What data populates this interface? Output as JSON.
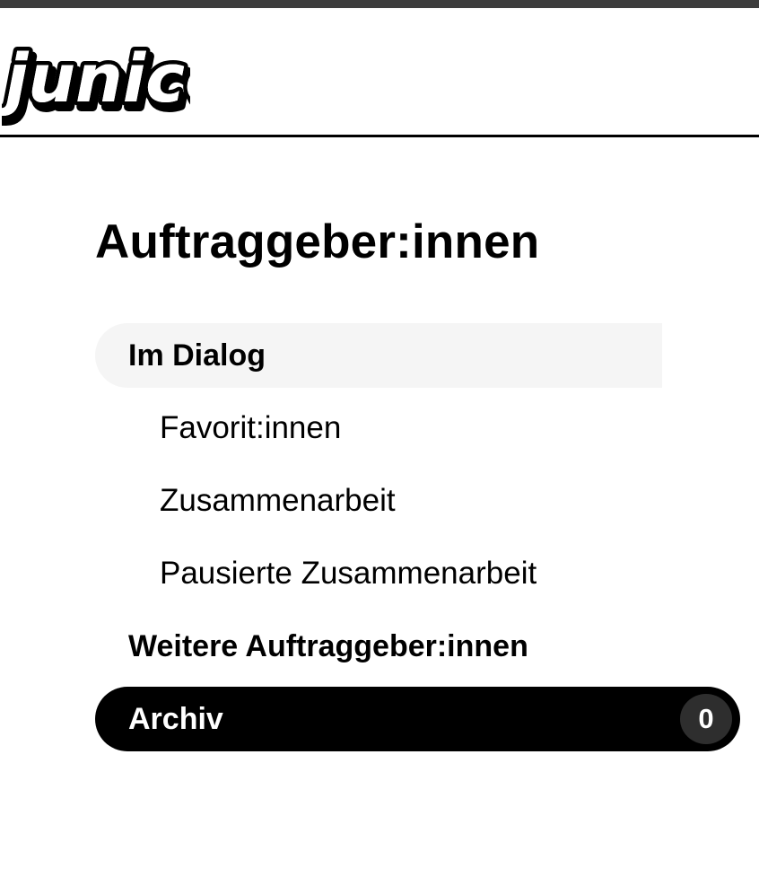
{
  "brand": {
    "logo_text": "junico",
    "logo_icon": "junico-logo"
  },
  "page": {
    "title": "Auftraggeber:innen"
  },
  "nav": {
    "items": [
      {
        "label": "Im Dialog",
        "level": "primary",
        "state": "expanded"
      },
      {
        "label": "Favorit:innen",
        "level": "sub"
      },
      {
        "label": "Zusammenarbeit",
        "level": "sub"
      },
      {
        "label": "Pausierte Zusammenarbeit",
        "level": "sub"
      },
      {
        "label": "Weitere Auftraggeber:innen",
        "level": "primary"
      },
      {
        "label": "Archiv",
        "level": "primary",
        "state": "selected",
        "count": "0"
      }
    ]
  },
  "colors": {
    "top_strip": "#3d3d3d",
    "text": "#000000",
    "active_background": "#f5f5f5",
    "selected_background": "#000000",
    "badge_background": "#2e2e2e"
  }
}
